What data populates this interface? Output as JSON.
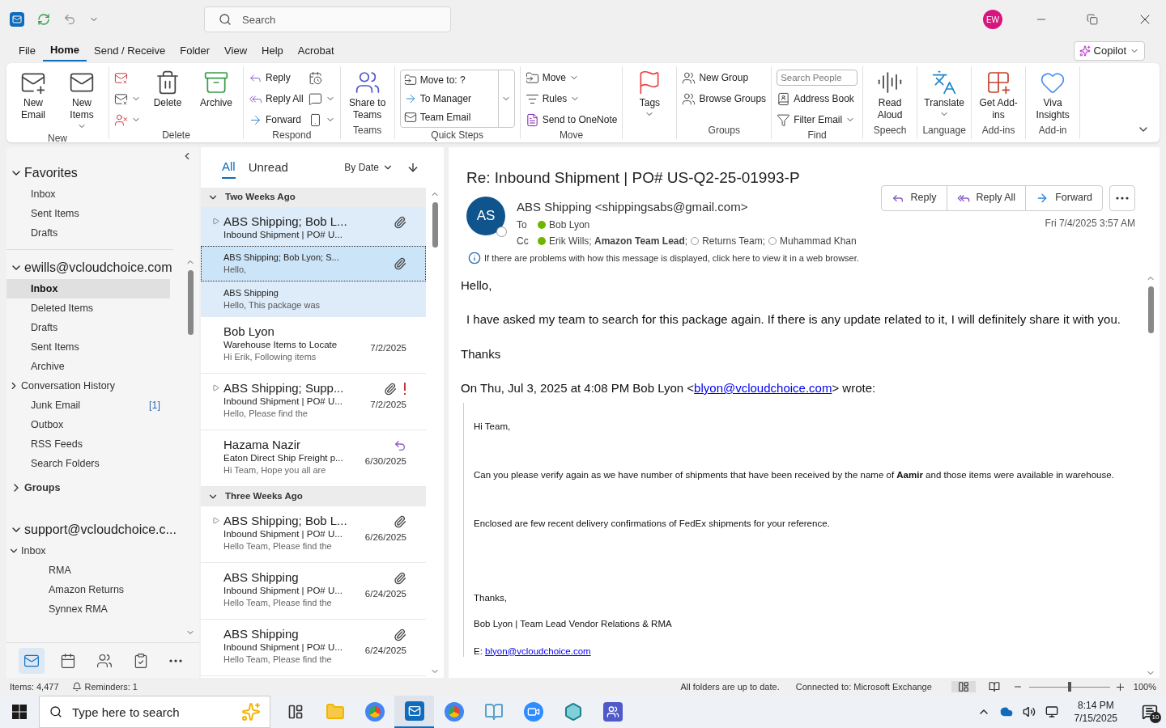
{
  "title_bar": {
    "search_placeholder": "Search",
    "avatar_initials": "EW"
  },
  "menu_tabs": [
    {
      "label": "File",
      "selected": false
    },
    {
      "label": "Home",
      "selected": true
    },
    {
      "label": "Send / Receive",
      "selected": false
    },
    {
      "label": "Folder",
      "selected": false
    },
    {
      "label": "View",
      "selected": false
    },
    {
      "label": "Help",
      "selected": false
    },
    {
      "label": "Acrobat",
      "selected": false
    }
  ],
  "copilot": {
    "label": "Copilot"
  },
  "ribbon": [
    {
      "label": "New",
      "buttons": [
        {
          "kind": "large",
          "label": "New Email",
          "dropdown": false
        },
        {
          "kind": "large",
          "label": "New Items",
          "dropdown": true
        }
      ]
    },
    {
      "label": "Delete",
      "buttons": [
        {
          "kind": "icon",
          "dropdown": false
        },
        {
          "kind": "icon",
          "dropdown": true
        },
        {
          "kind": "icon",
          "dropdown": true
        },
        {
          "kind": "large",
          "label": "Delete",
          "dropdown": false
        },
        {
          "kind": "large",
          "label": "Archive",
          "dropdown": false
        }
      ]
    },
    {
      "label": "Respond",
      "buttons": [
        {
          "kind": "small",
          "label": "Reply",
          "dropdown": false
        },
        {
          "kind": "small",
          "label": "Reply All",
          "dropdown": false
        },
        {
          "kind": "small",
          "label": "Forward",
          "dropdown": false
        },
        {
          "kind": "icon",
          "dropdown": false
        },
        {
          "kind": "icon",
          "dropdown": true
        },
        {
          "kind": "icon",
          "dropdown": true
        }
      ]
    },
    {
      "label": "Teams",
      "buttons": [
        {
          "kind": "large",
          "label": "Share to Teams",
          "dropdown": false
        }
      ]
    },
    {
      "label": "Quick Steps",
      "buttons": [
        {
          "kind": "quicksteps",
          "items": [
            "Move to: ?",
            "To Manager",
            "Team Email"
          ]
        }
      ]
    },
    {
      "label": "Move",
      "buttons": [
        {
          "kind": "small",
          "label": "Move",
          "dropdown": true
        },
        {
          "kind": "small",
          "label": "Rules",
          "dropdown": true
        },
        {
          "kind": "small",
          "label": "Send to OneNote",
          "dropdown": false
        }
      ]
    },
    {
      "buttons": [
        {
          "kind": "large",
          "label": "Tags",
          "dropdown": true
        }
      ]
    },
    {
      "label": "Groups",
      "buttons": [
        {
          "kind": "small",
          "label": "New Group",
          "dropdown": false
        },
        {
          "kind": "small",
          "label": "Browse Groups",
          "dropdown": false
        }
      ]
    },
    {
      "label": "Find",
      "buttons": [
        {
          "kind": "search",
          "placeholder": "Search People"
        },
        {
          "kind": "small",
          "label": "Address Book",
          "dropdown": false
        },
        {
          "kind": "small",
          "label": "Filter Email",
          "dropdown": true
        }
      ]
    },
    {
      "label": "Speech",
      "buttons": [
        {
          "kind": "large",
          "label": "Read Aloud",
          "dropdown": false
        }
      ]
    },
    {
      "label": "Language",
      "buttons": [
        {
          "kind": "large",
          "label": "Translate",
          "dropdown": true
        }
      ]
    },
    {
      "label": "Add-ins",
      "buttons": [
        {
          "kind": "large",
          "label": "Get Add-ins",
          "dropdown": false
        }
      ]
    },
    {
      "label": "Add-in",
      "buttons": [
        {
          "kind": "large",
          "label": "Viva Insights",
          "dropdown": false
        }
      ]
    }
  ],
  "folder_pane": {
    "favorites": {
      "label": "Favorites",
      "expanded": true,
      "folders": [
        {
          "label": "Inbox",
          "selected": false
        },
        {
          "label": "Sent Items",
          "selected": false
        },
        {
          "label": "Drafts",
          "selected": false
        }
      ]
    },
    "accounts": [
      {
        "label": "ewills@vcloudchoice.com",
        "expanded": true,
        "folders": [
          {
            "label": "Inbox",
            "selected": true
          },
          {
            "label": "Deleted Items",
            "selected": false
          },
          {
            "label": "Drafts",
            "selected": false
          },
          {
            "label": "Sent Items",
            "selected": false
          },
          {
            "label": "Archive",
            "selected": false
          },
          {
            "label": "Conversation History",
            "selected": false,
            "expanded": false
          },
          {
            "label": "Junk Email",
            "selected": false,
            "count": "[1]"
          },
          {
            "label": "Outbox",
            "selected": false
          },
          {
            "label": "RSS Feeds",
            "selected": false
          },
          {
            "label": "Search Folders",
            "selected": false
          }
        ]
      },
      {
        "label": "Groups",
        "expanded": false
      },
      {
        "label": "support@vcloudchoice.c...",
        "expanded": true,
        "folders": [
          {
            "label": "Inbox",
            "selected": false,
            "expanded": true,
            "children": [
              {
                "label": "RMA",
                "selected": false
              },
              {
                "label": "Amazon Returns",
                "selected": false
              },
              {
                "label": "Synnex RMA",
                "selected": false
              }
            ]
          }
        ]
      }
    ]
  },
  "nav_bar": [
    {
      "selected": true
    },
    {
      "selected": false
    },
    {
      "selected": false
    },
    {
      "selected": false
    },
    {
      "selected": false
    }
  ],
  "message_list": {
    "tabs": [
      {
        "label": "All",
        "selected": true
      },
      {
        "label": "Unread",
        "selected": false
      }
    ],
    "sort": "By Date",
    "groups": [
      {
        "label": "Two Weeks Ago",
        "expanded": true,
        "messages": [
          {
            "kind": "conversation",
            "sender": "ABS Shipping;  Bob L...",
            "subject": "Inbound Shipment | PO# U...",
            "attachment": true,
            "important": false,
            "replied": false,
            "highlighted": true,
            "selected": false
          },
          {
            "kind": "child",
            "sender": "ABS Shipping;  Bob Lyon;  S...",
            "preview": "Hello,",
            "attachment": true,
            "important": false,
            "replied": false,
            "highlighted": true,
            "selected": true
          },
          {
            "kind": "child",
            "sender": "ABS Shipping",
            "preview": "Hello,  This package was",
            "attachment": false,
            "important": false,
            "replied": false,
            "highlighted": true,
            "selected": false
          },
          {
            "kind": "single",
            "sender": "Bob Lyon",
            "subject": "Warehouse Items to Locate",
            "preview": "Hi Erik,  Following items",
            "date": "7/2/2025",
            "attachment": false,
            "important": false,
            "replied": false,
            "highlighted": false,
            "selected": false
          },
          {
            "kind": "conversation",
            "sender": "ABS Shipping;  Supp...",
            "subject": "Inbound Shipment | PO# U...",
            "preview": "Hello,  Please find the",
            "date": "7/2/2025",
            "attachment": true,
            "important": true,
            "replied": false,
            "highlighted": false,
            "selected": false
          },
          {
            "kind": "single",
            "sender": "Hazama Nazir",
            "subject": "Eaton Direct Ship Freight p...",
            "preview": "Hi Team,  Hope you all are",
            "date": "6/30/2025",
            "attachment": false,
            "important": false,
            "replied": true,
            "highlighted": false,
            "selected": false
          }
        ]
      },
      {
        "label": "Three Weeks Ago",
        "expanded": true,
        "messages": [
          {
            "kind": "conversation",
            "sender": "ABS Shipping;  Bob L...",
            "subject": "Inbound Shipment | PO# U...",
            "preview": "Hello Team,  Please find the",
            "date": "6/26/2025",
            "attachment": true,
            "important": false,
            "replied": false,
            "highlighted": false,
            "selected": false
          },
          {
            "kind": "single",
            "sender": "ABS Shipping",
            "subject": "Inbound Shipment | PO# U...",
            "preview": "Hello Team,  Please find the",
            "date": "6/24/2025",
            "attachment": true,
            "important": false,
            "replied": false,
            "highlighted": false,
            "selected": false
          },
          {
            "kind": "single",
            "sender": "ABS Shipping",
            "subject": "Inbound Shipment | PO# U...",
            "preview": "Hello Team,  Please find the",
            "date": "6/24/2025",
            "attachment": true,
            "important": false,
            "replied": false,
            "highlighted": false,
            "selected": false
          }
        ]
      }
    ]
  },
  "reading_pane": {
    "subject": "Re: Inbound Shipment | PO# US-Q2-25-01993-P",
    "avatar_initials": "AS",
    "from": "ABS Shipping <shippingsabs@gmail.com>",
    "to_label": "To",
    "to": [
      {
        "name": "Bob Lyon",
        "kind": "available"
      }
    ],
    "cc_label": "Cc",
    "cc": [
      {
        "name": "Erik Wills; **Amazon Team Lead**;",
        "kind": "available"
      },
      {
        "name": "Returns Team;",
        "kind": "unknown"
      },
      {
        "name": "Muhammad Khan",
        "kind": "unknown"
      }
    ],
    "actions": [
      "Reply",
      "Reply All",
      "Forward"
    ],
    "date": "Fri 7/4/2025 3:57 AM",
    "info": "If there are problems with how this message is displayed, click here to view it in a web browser.",
    "body": [
      "Hello,",
      "I have asked my team to search for this package again. If there is any update related to it, I will definitely share it with you.",
      "Thanks"
    ],
    "quote_header": {
      "before": "On Thu, Jul 3, 2025 at 4:08 PM Bob Lyon <",
      "link": "blyon@vcloudchoice.com",
      "after": "> wrote:"
    },
    "quoted": [
      "Hi Team,",
      "Can you please verify again as we have number of shipments that have been received by the name of **Aamir** and those items were available in warehouse.",
      "Enclosed are few recent delivery confirmations of FedEx shipments for your reference.",
      "Thanks,",
      "Bob Lyon | Team Lead Vendor Relations & RMA"
    ],
    "signature_email": {
      "label": "E:",
      "link": "blyon@vcloudchoice.com"
    }
  },
  "status_bar": {
    "items": "Items: 4,477",
    "reminders": "Reminders: 1",
    "sync": "All folders are up to date.",
    "connection": "Connected to: Microsoft Exchange",
    "zoom": {
      "level": 0.5
    },
    "zoom_label": "100%"
  },
  "taskbar": {
    "search_placeholder": "Type here to search",
    "apps": [
      {
        "selected": false
      },
      {
        "selected": false
      },
      {
        "selected": false
      },
      {
        "selected": true
      },
      {
        "selected": false
      },
      {
        "selected": false
      },
      {
        "selected": false
      },
      {
        "selected": false
      },
      {
        "selected": false
      }
    ],
    "time": "8:14 PM",
    "date": "7/15/2025",
    "notifications": "10"
  }
}
